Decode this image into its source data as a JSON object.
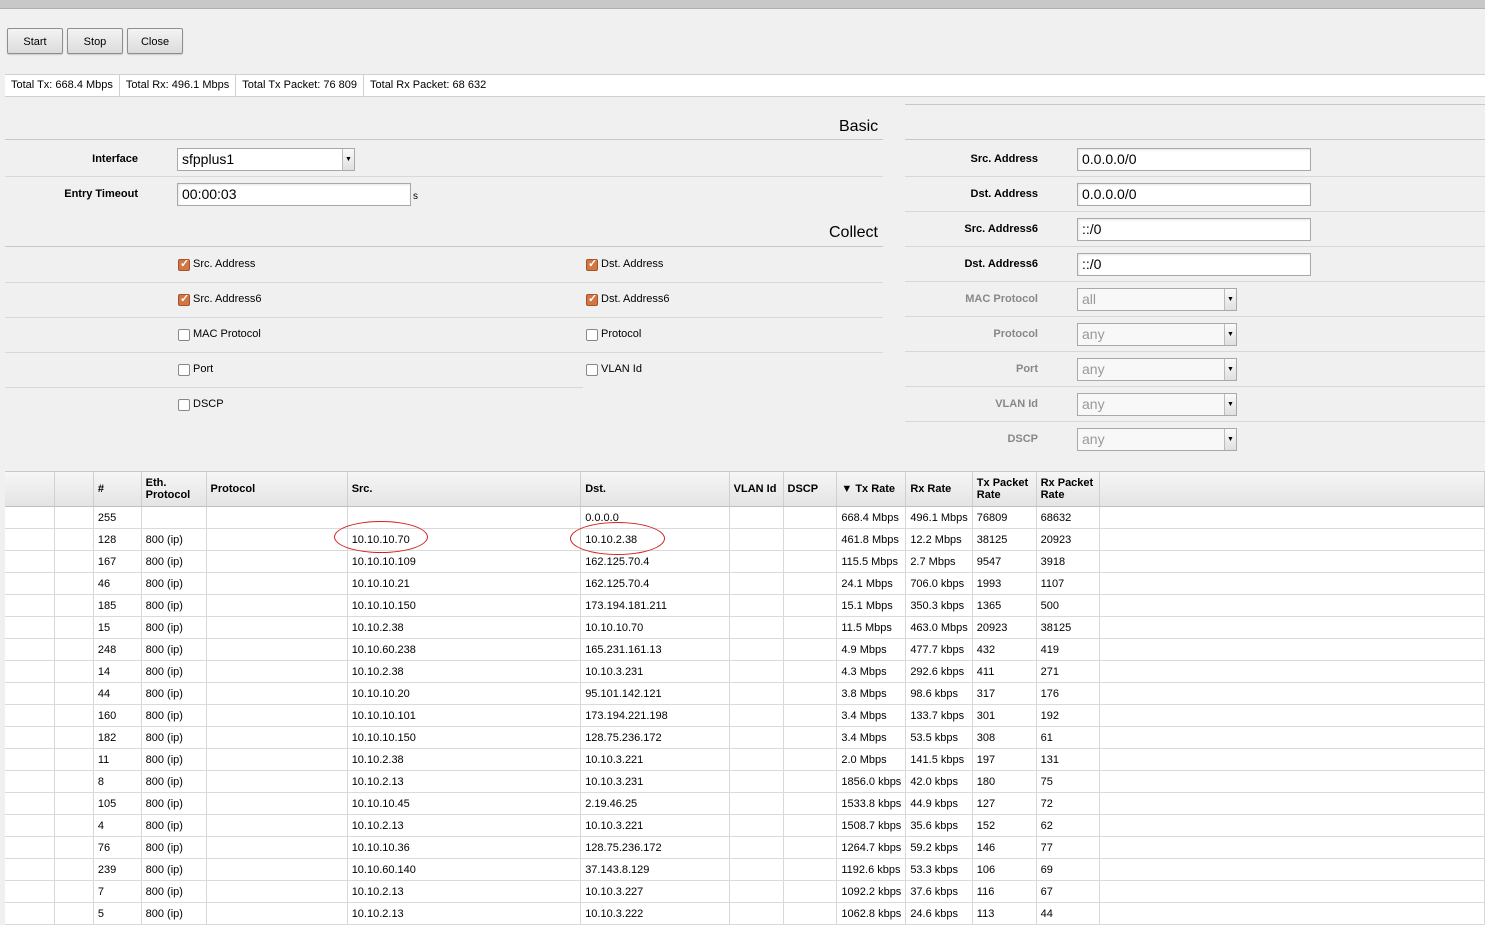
{
  "toolbar": {
    "start": "Start",
    "stop": "Stop",
    "close": "Close"
  },
  "status": {
    "total_tx": "Total Tx: 668.4 Mbps",
    "total_rx": "Total Rx: 496.1 Mbps",
    "total_tx_packet": "Total Tx Packet: 76 809",
    "total_rx_packet": "Total Rx Packet: 68 632"
  },
  "basic": {
    "title": "Basic",
    "interface_label": "Interface",
    "interface_value": "sfpplus1",
    "entry_timeout_label": "Entry Timeout",
    "entry_timeout_value": "00:00:03",
    "entry_timeout_unit": "s"
  },
  "collect": {
    "title": "Collect",
    "items": [
      {
        "label": "Src. Address",
        "checked": true
      },
      {
        "label": "Dst. Address",
        "checked": true
      },
      {
        "label": "Src. Address6",
        "checked": true
      },
      {
        "label": "Dst. Address6",
        "checked": true
      },
      {
        "label": "MAC Protocol",
        "checked": false
      },
      {
        "label": "Protocol",
        "checked": false
      },
      {
        "label": "Port",
        "checked": false
      },
      {
        "label": "VLAN Id",
        "checked": false
      },
      {
        "label": "DSCP",
        "checked": false
      }
    ]
  },
  "filter": {
    "src_address_label": "Src. Address",
    "src_address_value": "0.0.0.0/0",
    "dst_address_label": "Dst. Address",
    "dst_address_value": "0.0.0.0/0",
    "src_address6_label": "Src. Address6",
    "src_address6_value": "::/0",
    "dst_address6_label": "Dst. Address6",
    "dst_address6_value": "::/0",
    "mac_protocol_label": "MAC Protocol",
    "mac_protocol_value": "all",
    "protocol_label": "Protocol",
    "protocol_value": "any",
    "port_label": "Port",
    "port_value": "any",
    "vlan_id_label": "VLAN Id",
    "vlan_id_value": "any",
    "dscp_label": "DSCP",
    "dscp_value": "any"
  },
  "table": {
    "columns": [
      "",
      "",
      "#",
      "Eth. Protocol",
      "Protocol",
      "Src.",
      "Dst.",
      "VLAN Id",
      "DSCP",
      "▼ Tx Rate",
      "Rx Rate",
      "Tx Packet Rate",
      "Rx Packet Rate"
    ],
    "rows": [
      [
        "255",
        "",
        "",
        "",
        "0.0.0.0",
        "",
        "",
        "668.4 Mbps",
        "496.1 Mbps",
        "76809",
        "68632"
      ],
      [
        "128",
        "800 (ip)",
        "",
        "10.10.10.70",
        "10.10.2.38",
        "",
        "",
        "461.8 Mbps",
        "12.2 Mbps",
        "38125",
        "20923"
      ],
      [
        "167",
        "800 (ip)",
        "",
        "10.10.10.109",
        "162.125.70.4",
        "",
        "",
        "115.5 Mbps",
        "2.7 Mbps",
        "9547",
        "3918"
      ],
      [
        "46",
        "800 (ip)",
        "",
        "10.10.10.21",
        "162.125.70.4",
        "",
        "",
        "24.1 Mbps",
        "706.0 kbps",
        "1993",
        "1107"
      ],
      [
        "185",
        "800 (ip)",
        "",
        "10.10.10.150",
        "173.194.181.211",
        "",
        "",
        "15.1 Mbps",
        "350.3 kbps",
        "1365",
        "500"
      ],
      [
        "15",
        "800 (ip)",
        "",
        "10.10.2.38",
        "10.10.10.70",
        "",
        "",
        "11.5 Mbps",
        "463.0 Mbps",
        "20923",
        "38125"
      ],
      [
        "248",
        "800 (ip)",
        "",
        "10.10.60.238",
        "165.231.161.13",
        "",
        "",
        "4.9 Mbps",
        "477.7 kbps",
        "432",
        "419"
      ],
      [
        "14",
        "800 (ip)",
        "",
        "10.10.2.38",
        "10.10.3.231",
        "",
        "",
        "4.3 Mbps",
        "292.6 kbps",
        "411",
        "271"
      ],
      [
        "44",
        "800 (ip)",
        "",
        "10.10.10.20",
        "95.101.142.121",
        "",
        "",
        "3.8 Mbps",
        "98.6 kbps",
        "317",
        "176"
      ],
      [
        "160",
        "800 (ip)",
        "",
        "10.10.10.101",
        "173.194.221.198",
        "",
        "",
        "3.4 Mbps",
        "133.7 kbps",
        "301",
        "192"
      ],
      [
        "182",
        "800 (ip)",
        "",
        "10.10.10.150",
        "128.75.236.172",
        "",
        "",
        "3.4 Mbps",
        "53.5 kbps",
        "308",
        "61"
      ],
      [
        "11",
        "800 (ip)",
        "",
        "10.10.2.38",
        "10.10.3.221",
        "",
        "",
        "2.0 Mbps",
        "141.5 kbps",
        "197",
        "131"
      ],
      [
        "8",
        "800 (ip)",
        "",
        "10.10.2.13",
        "10.10.3.231",
        "",
        "",
        "1856.0 kbps",
        "42.0 kbps",
        "180",
        "75"
      ],
      [
        "105",
        "800 (ip)",
        "",
        "10.10.10.45",
        "2.19.46.25",
        "",
        "",
        "1533.8 kbps",
        "44.9 kbps",
        "127",
        "72"
      ],
      [
        "4",
        "800 (ip)",
        "",
        "10.10.2.13",
        "10.10.3.221",
        "",
        "",
        "1508.7 kbps",
        "35.6 kbps",
        "152",
        "62"
      ],
      [
        "76",
        "800 (ip)",
        "",
        "10.10.10.36",
        "128.75.236.172",
        "",
        "",
        "1264.7 kbps",
        "59.2 kbps",
        "146",
        "77"
      ],
      [
        "239",
        "800 (ip)",
        "",
        "10.10.60.140",
        "37.143.8.129",
        "",
        "",
        "1192.6 kbps",
        "53.3 kbps",
        "106",
        "69"
      ],
      [
        "7",
        "800 (ip)",
        "",
        "10.10.2.13",
        "10.10.3.227",
        "",
        "",
        "1092.2 kbps",
        "37.6 kbps",
        "116",
        "67"
      ],
      [
        "5",
        "800 (ip)",
        "",
        "10.10.2.13",
        "10.10.3.222",
        "",
        "",
        "1062.8 kbps",
        "24.6 kbps",
        "113",
        "44"
      ]
    ]
  },
  "colors": {
    "checkbox_checked": "#d27644",
    "highlight_circle": "#d42020"
  }
}
